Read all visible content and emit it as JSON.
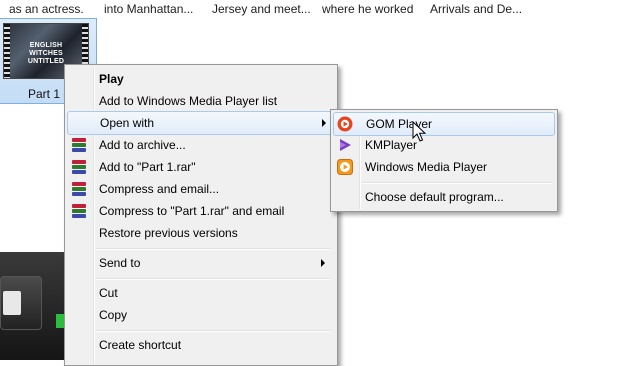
{
  "explorer": {
    "captions": [
      "as an actress.",
      "into Manhattan...",
      "Jersey and meet...",
      "where he worked",
      "Arrivals and De..."
    ],
    "file_name": "Part 1",
    "thumbnail_text": [
      "ENGLISH",
      "WITCHES",
      "UNTITLED"
    ]
  },
  "context_menu": {
    "items": [
      {
        "label": "Play",
        "bold": true
      },
      {
        "label": "Add to Windows Media Player list"
      },
      {
        "label": "Open with",
        "submenu": true
      },
      {
        "label": "Add to archive...",
        "icon": "winrar-icon"
      },
      {
        "label": "Add to \"Part 1.rar\"",
        "icon": "winrar-icon"
      },
      {
        "label": "Compress and email...",
        "icon": "winrar-icon"
      },
      {
        "label": "Compress to \"Part 1.rar\" and email",
        "icon": "winrar-icon"
      },
      {
        "label": "Restore previous versions"
      },
      {
        "label": "Send to",
        "submenu": true
      },
      {
        "label": "Cut"
      },
      {
        "label": "Copy"
      },
      {
        "label": "Create shortcut"
      }
    ]
  },
  "open_with_menu": {
    "items": [
      {
        "label": "GOM Player",
        "icon": "gom-player-icon"
      },
      {
        "label": "KMPlayer",
        "icon": "kmplayer-icon"
      },
      {
        "label": "Windows Media Player",
        "icon": "windows-media-player-icon"
      },
      {
        "label": "Choose default program..."
      }
    ]
  }
}
